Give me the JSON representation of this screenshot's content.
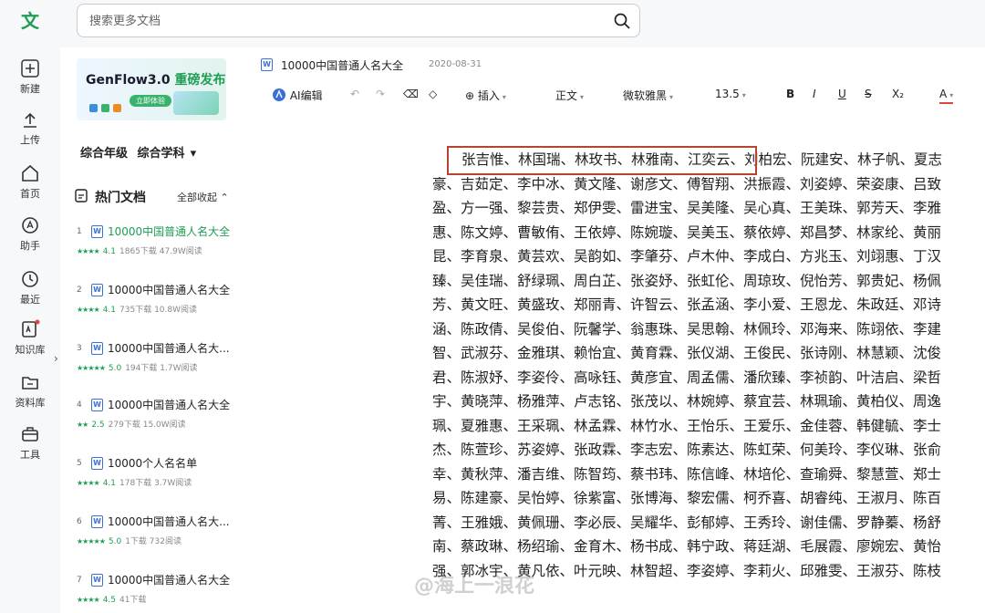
{
  "app": {
    "logo": "文"
  },
  "rail": [
    {
      "label": "新建",
      "icon": "plus-icon"
    },
    {
      "label": "上传",
      "icon": "upload-icon"
    },
    {
      "label": "首页",
      "icon": "home-icon"
    },
    {
      "label": "助手",
      "icon": "assistant-icon"
    },
    {
      "label": "最近",
      "icon": "clock-icon"
    },
    {
      "label": "知识库",
      "icon": "knowledge-icon"
    },
    {
      "label": "资料库",
      "icon": "folder-icon"
    },
    {
      "label": "工具",
      "icon": "toolbox-icon"
    }
  ],
  "search": {
    "placeholder": "搜索更多文档"
  },
  "banner": {
    "title_a": "GenFlow3.0 ",
    "title_b": "重磅发布",
    "cta": "立即体验"
  },
  "filter": {
    "grade": "综合年级",
    "subject": "综合学科"
  },
  "hot": {
    "title": "热门文档",
    "collapse_all": "全部收起"
  },
  "docs": [
    {
      "num": "1",
      "name": "10000中国普通人名大全",
      "stars": "★★★★",
      "score": "4.1",
      "downloads": "1865下载",
      "reads": "47.9W阅读"
    },
    {
      "num": "2",
      "name": "10000中国普通人名大全",
      "stars": "★★★★",
      "score": "4.1",
      "downloads": "735下载",
      "reads": "10.8W阅读"
    },
    {
      "num": "3",
      "name": "10000中国普通人名大...",
      "stars": "★★★★★",
      "score": "5.0",
      "downloads": "194下载",
      "reads": "1.7W阅读"
    },
    {
      "num": "4",
      "name": "10000中国普通人名大全",
      "stars": "★★",
      "score": "2.5",
      "downloads": "279下载",
      "reads": "15.0W阅读"
    },
    {
      "num": "5",
      "name": "10000个人名名单",
      "stars": "★★★★",
      "score": "4.1",
      "downloads": "178下载",
      "reads": "3.7W阅读"
    },
    {
      "num": "6",
      "name": "10000中国普通人名大...",
      "stars": "★★★★★",
      "score": "5.0",
      "downloads": "1下载",
      "reads": "732阅读"
    },
    {
      "num": "7",
      "name": "10000中国普通人名大全",
      "stars": "★★★★",
      "score": "4.5",
      "downloads": "41下载",
      "reads": ""
    }
  ],
  "file": {
    "title": "10000中国普通人名大全",
    "date": "2020-08-31"
  },
  "toolbar": {
    "ai": "AI编辑",
    "insert": "插入",
    "style": "正文",
    "font": "微软雅黑",
    "size": "13.5",
    "bold": "B",
    "italic": "I",
    "underline": "U",
    "strike": "S",
    "sub": "X₂",
    "color": "A"
  },
  "document": {
    "lines": [
      "张吉惟、林国瑞、林玫书、林雅南、江奕云、刘柏宏、阮建安、林子帆、夏志",
      "豪、吉茹定、李中冰、黄文隆、谢彦文、傅智翔、洪振霞、刘姿婷、荣姿康、吕致",
      "盈、方一强、黎芸贵、郑伊雯、雷进宝、吴美隆、吴心真、王美珠、郭芳天、李雅",
      "惠、陈文婷、曹敏侑、王依婷、陈婉璇、吴美玉、蔡依婷、郑昌梦、林家纶、黄丽",
      "昆、李育泉、黄芸欢、吴韵如、李肇芬、卢木仲、李成白、方兆玉、刘翊惠、丁汉",
      "臻、吴佳瑞、舒绿珮、周白芷、张姿妤、张虹伦、周琼玫、倪怡芳、郭贵妃、杨佩",
      "芳、黄文旺、黄盛玫、郑丽青、许智云、张孟涵、李小爱、王恩龙、朱政廷、邓诗",
      "涵、陈政倩、吴俊伯、阮馨学、翁惠珠、吴思翰、林佩玲、邓海来、陈翊依、李建",
      "智、武淑芬、金雅琪、赖怡宜、黄育霖、张仪湖、王俊民、张诗刚、林慧颖、沈俊",
      "君、陈淑妤、李姿伶、高咏钰、黄彦宜、周孟儒、潘欣臻、李祯韵、叶洁启、梁哲",
      "宇、黄晓萍、杨雅萍、卢志铭、张茂以、林婉婷、蔡宜芸、林珮瑜、黄柏仪、周逸",
      "珮、夏雅惠、王采珮、林孟霖、林竹水、王怡乐、王爱乐、金佳蓉、韩健毓、李士",
      "杰、陈萱珍、苏姿婷、张政霖、李志宏、陈素达、陈虹荣、何美玲、李仪琳、张俞",
      "幸、黄秋萍、潘吉维、陈智筠、蔡书玮、陈信峰、林培伦、查瑜舜、黎慧萱、郑士",
      "易、陈建豪、吴怡婷、徐紫富、张博海、黎宏儒、柯乔喜、胡睿纯、王淑月、陈百",
      "菁、王雅娥、黄佩珊、李必辰、吴耀华、彭郁婷、王秀玲、谢佳儒、罗静蓁、杨舒",
      "南、蔡政琳、杨绍瑜、金育木、杨书成、韩宁政、蒋廷湖、毛展霞、廖婉宏、黄怡",
      "强、郭冰宇、黄凡依、叶元映、林智超、李姿婷、李莉火、邱雅雯、王淑芬、陈枝"
    ],
    "watermark": "@海上一浪花"
  }
}
